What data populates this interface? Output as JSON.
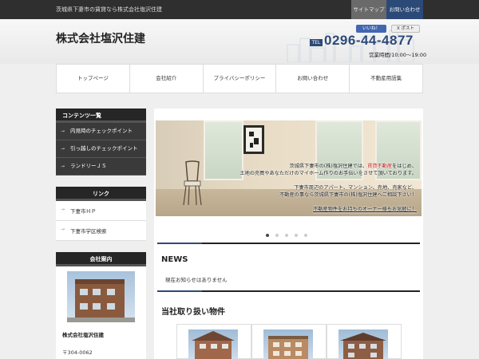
{
  "topbar": {
    "tagline": "茨城県下妻市の賃貸なら株式会社塩沢住建",
    "sitemap": "サイトマップ",
    "contact": "お問い合わせ"
  },
  "header": {
    "company": "株式会社塩沢住建",
    "like_label": "いいね！",
    "post_label": "X ポスト",
    "tel_badge": "TEL",
    "tel": "0296-44-4877",
    "hours": "営業時間/10:00～19:00"
  },
  "nav": {
    "items": [
      "トップページ",
      "会社紹介",
      "プライバシーポリシー",
      "お問い合わせ",
      "不動産用語集"
    ]
  },
  "sidebar": {
    "contents": {
      "title": "コンテンツ一覧",
      "items": [
        "内見時のチェックポイント",
        "引っ越しのチェックポイント",
        "ランドリーＪＳ"
      ]
    },
    "links": {
      "title": "リンク",
      "items": [
        "下妻市ＨＰ",
        "下妻市学区検索"
      ]
    },
    "company": {
      "title": "会社案内",
      "name": "株式会社塩沢住建",
      "zip": "〒304-0062"
    }
  },
  "slider": {
    "line1_a": "茨城県下妻市の(株)塩沢住建では、",
    "line1_b": "賃貸不動産",
    "line1_c": "をはじめ、",
    "line2": "土地の売買やあなただけのマイホーム作りのお手伝いをさせて頂いております。",
    "line3": "下妻市周辺のアパート、マンション、売地、売家など、",
    "line4": "不動産の事なら茨城県下妻市の(株)塩沢住建へご相談下さい！",
    "line5": "不動産物件をお持ちのオーナー様もお気軽に！",
    "active_index": 0,
    "slide_count": 5
  },
  "news": {
    "title": "NEWS",
    "empty": "現在お知らせはありません"
  },
  "properties": {
    "title": "当社取り扱い物件",
    "count": 3
  },
  "colors": {
    "accent": "#2c4a78",
    "dark": "#262626",
    "highlight": "#c41d1d"
  }
}
